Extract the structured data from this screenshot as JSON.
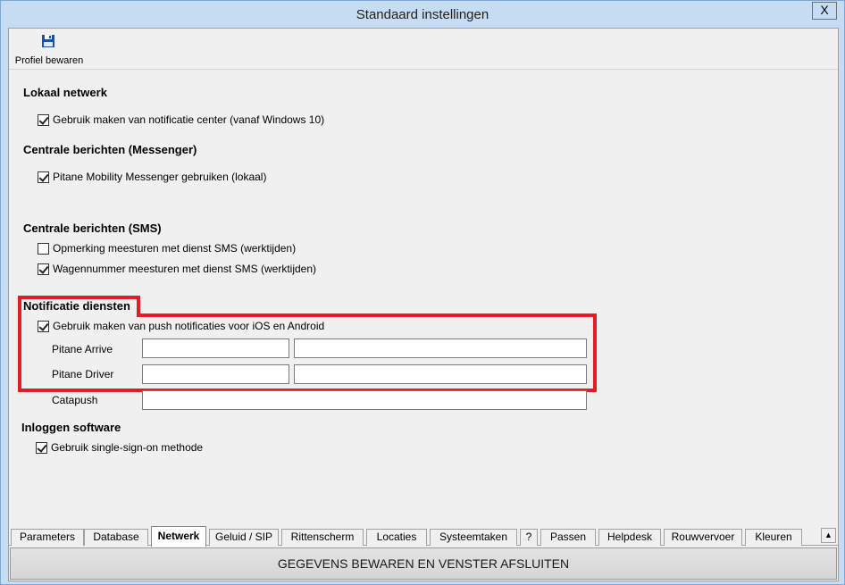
{
  "window": {
    "title": "Standaard instellingen",
    "close_label": "X"
  },
  "toolbar": {
    "save_profile_label": "Profiel bewaren",
    "save_icon": "floppy-disk-icon"
  },
  "sections": {
    "local_network": {
      "title": "Lokaal netwerk",
      "notification_center": {
        "label": "Gebruik maken van notificatie center (vanaf Windows 10)",
        "checked": true
      }
    },
    "messenger": {
      "title": "Centrale berichten (Messenger)",
      "use_messenger": {
        "label": "Pitane Mobility Messenger gebruiken (lokaal)",
        "checked": true
      }
    },
    "sms": {
      "title": "Centrale berichten (SMS)",
      "remark": {
        "label": "Opmerking meesturen met dienst SMS (werktijden)",
        "checked": false
      },
      "vehicle": {
        "label": "Wagennummer meesturen met dienst SMS (werktijden)",
        "checked": true
      }
    },
    "notifications": {
      "title": "Notificatie diensten",
      "push": {
        "label": "Gebruik maken van push notificaties voor iOS en Android",
        "checked": true
      },
      "arrive_label": "Pitane Arrive",
      "driver_label": "Pitane Driver",
      "catapush_label": "Catapush",
      "arrive_key": "",
      "arrive_secret": "",
      "driver_key": "",
      "driver_secret": "",
      "catapush_value": ""
    },
    "login": {
      "title": "Inloggen software",
      "sso": {
        "label": "Gebruik single-sign-on methode",
        "checked": true
      }
    }
  },
  "tabs": [
    "Parameters",
    "Database",
    "Netwerk",
    "Geluid / SIP",
    "Rittenscherm",
    "Locaties",
    "Systeemtaken",
    "?",
    "Passen",
    "Helpdesk",
    "Rouwvervoer",
    "Kleuren"
  ],
  "active_tab": "Netwerk",
  "footer": {
    "save_close_label": "GEGEVENS BEWAREN EN VENSTER AFSLUITEN"
  },
  "colors": {
    "highlight": "#e31c25",
    "titlebar": "#c6dcf2"
  }
}
